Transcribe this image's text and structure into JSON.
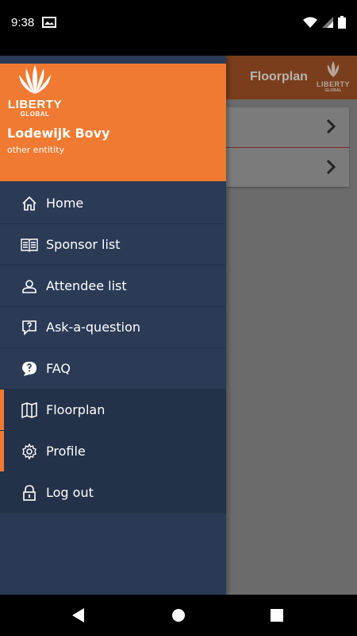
{
  "status_bar": {
    "time": "9:38"
  },
  "app": {
    "title": "Floorplan",
    "logo_brand": "LIBERTY",
    "logo_sub": "GLOBAL"
  },
  "drawer": {
    "logo_brand": "LIBERTY",
    "logo_sub": "GLOBAL",
    "user_name": "Lodewijk Bovy",
    "user_org": "other entitity",
    "items": [
      {
        "label": "Home",
        "icon": "home-icon"
      },
      {
        "label": "Sponsor list",
        "icon": "book-icon"
      },
      {
        "label": "Attendee list",
        "icon": "person-icon"
      },
      {
        "label": "Ask-a-question",
        "icon": "question-bubble-icon"
      },
      {
        "label": "FAQ",
        "icon": "faq-icon"
      },
      {
        "label": "Floorplan",
        "icon": "map-icon",
        "active": true
      },
      {
        "label": "Profile",
        "icon": "gear-icon"
      },
      {
        "label": "Log out",
        "icon": "lock-icon"
      }
    ]
  },
  "colors": {
    "accent": "#f07a31",
    "drawer_bg": "#2a3a55",
    "drawer_active": "#243249"
  }
}
